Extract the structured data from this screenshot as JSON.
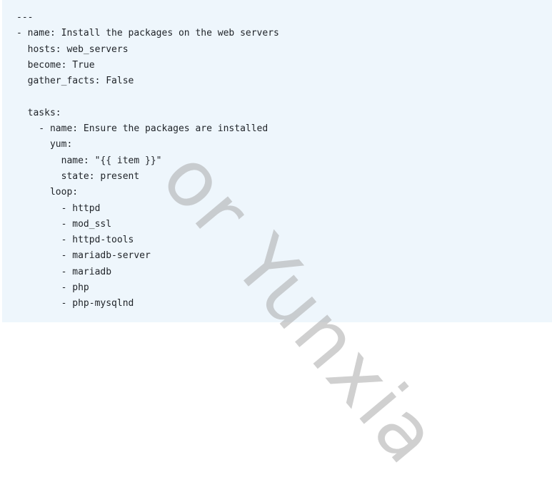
{
  "code": {
    "language": "yaml",
    "lines": [
      "---",
      "- name: Install the packages on the web servers",
      "  hosts: web_servers",
      "  become: True",
      "  gather_facts: False",
      "",
      "  tasks:",
      "    - name: Ensure the packages are installed",
      "      yum:",
      "        name: \"{{ item }}\"",
      "        state: present",
      "      loop:",
      "        - httpd",
      "        - mod_ssl",
      "        - httpd-tools",
      "        - mariadb-server",
      "        - mariadb",
      "        - php",
      "        - php-mysqlnd"
    ]
  },
  "watermark": {
    "text": "or Yunxia",
    "color": "#aaaaaa"
  },
  "colors": {
    "panel_background": "#eef6fc",
    "text": "#1f2328"
  }
}
